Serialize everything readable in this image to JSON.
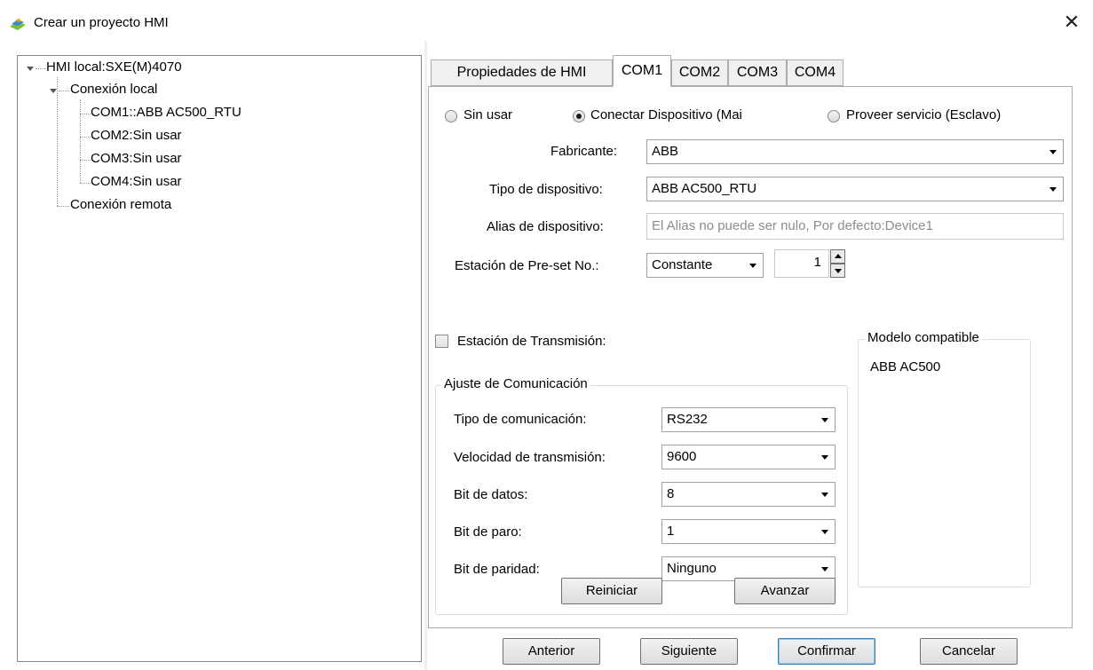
{
  "window": {
    "title": "Crear un proyecto HMI",
    "close_glyph": "✕",
    "icon": "app-logo-icon"
  },
  "tree": {
    "root": "HMI local:SXE(M)4070",
    "local": "Conexión local",
    "com1": "COM1::ABB AC500_RTU",
    "com2": "COM2:Sin usar",
    "com3": "COM3:Sin usar",
    "com4": "COM4:Sin usar",
    "remote": "Conexión remota"
  },
  "tabs": [
    "Propiedades de HMI",
    "COM1",
    "COM2",
    "COM3",
    "COM4"
  ],
  "active_tab": "COM1",
  "mode": {
    "unused": "Sin usar",
    "master": "Conectar Dispositivo (Mai",
    "slave": "Proveer servicio (Esclavo)",
    "selected": "master"
  },
  "device": {
    "manufacturer_label": "Fabricante:",
    "manufacturer_value": "ABB",
    "type_label": "Tipo de dispositivo:",
    "type_value": "ABB AC500_RTU",
    "alias_label": "Alias de dispositivo:",
    "alias_placeholder": "El Alias no puede ser nulo, Por defecto:Device1",
    "station_label": "Estación de Pre-set No.:",
    "station_mode": "Constante",
    "station_number": "1"
  },
  "broadcast": {
    "label": "Estación de Transmisión:",
    "checked": false
  },
  "comm": {
    "group_title": "Ajuste de Comunicación",
    "type_label": "Tipo de comunicación:",
    "type_value": "RS232",
    "baud_label": "Velocidad de transmisión:",
    "baud_value": "9600",
    "data_label": "Bit de datos:",
    "data_value": "8",
    "stop_label": "Bit de paro:",
    "stop_value": "1",
    "parity_label": "Bit de paridad:",
    "parity_value": "Ninguno",
    "reset_button": "Reiniciar",
    "advanced_button": "Avanzar"
  },
  "compatible": {
    "title": "Modelo compatible",
    "model": "ABB AC500"
  },
  "footer": {
    "prev": "Anterior",
    "next": "Siguiente",
    "confirm": "Confirmar",
    "cancel": "Cancelar"
  }
}
